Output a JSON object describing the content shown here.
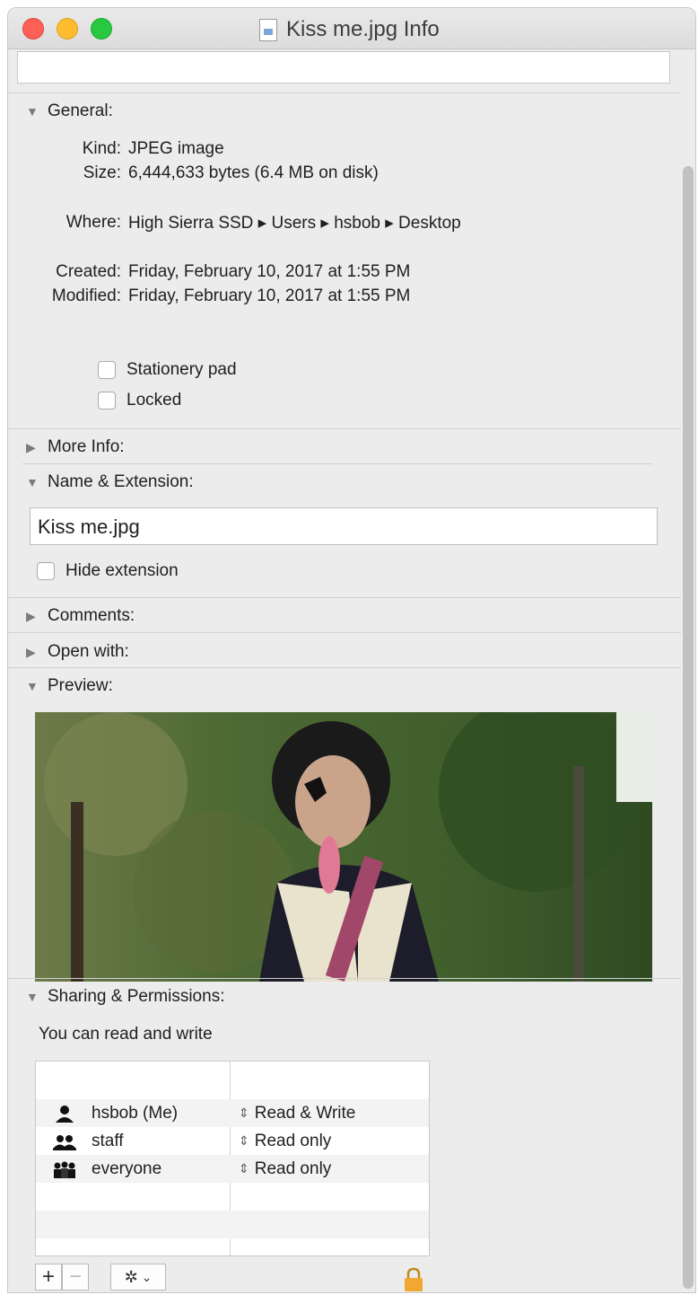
{
  "window": {
    "title": "Kiss me.jpg Info"
  },
  "general": {
    "header": "General:",
    "kind_label": "Kind:",
    "kind_value": "JPEG image",
    "size_label": "Size:",
    "size_value": "6,444,633 bytes (6.4 MB on disk)",
    "where_label": "Where:",
    "where_value": "High Sierra SSD ▸ Users ▸ hsbob ▸ Desktop",
    "created_label": "Created:",
    "created_value": "Friday, February 10, 2017 at 1:55 PM",
    "modified_label": "Modified:",
    "modified_value": "Friday, February 10, 2017 at 1:55 PM",
    "stationery_label": "Stationery pad",
    "locked_label": "Locked",
    "stationery_checked": false,
    "locked_checked": false
  },
  "more_info": {
    "header": "More Info:"
  },
  "name_extension": {
    "header": "Name & Extension:",
    "filename": "Kiss me.jpg",
    "hide_extension_label": "Hide extension",
    "hide_extension_checked": false
  },
  "comments": {
    "header": "Comments:"
  },
  "open_with": {
    "header": "Open with:"
  },
  "preview": {
    "header": "Preview:"
  },
  "sharing": {
    "header": "Sharing & Permissions:",
    "summary": "You can read and write",
    "rows": [
      {
        "name": "hsbob (Me)",
        "privilege": "Read & Write",
        "icon": "single-user-icon"
      },
      {
        "name": "staff",
        "privilege": "Read only",
        "icon": "group-icon"
      },
      {
        "name": "everyone",
        "privilege": "Read only",
        "icon": "everyone-icon"
      }
    ],
    "add_label": "+",
    "remove_label": "−"
  },
  "colors": {
    "close": "#fe5f57",
    "minimize": "#febc2e",
    "maximize": "#28c840",
    "lock": "#f0a830"
  }
}
